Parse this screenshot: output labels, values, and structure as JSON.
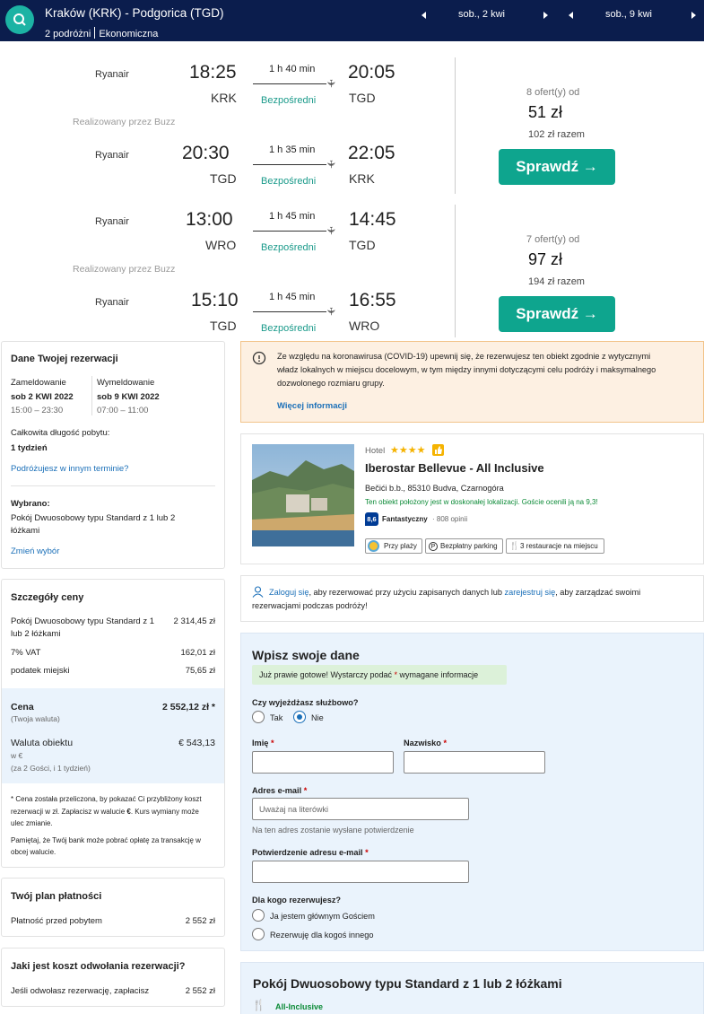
{
  "search": {
    "route": "Kraków (KRK) - Podgorica (TGD)",
    "travellers": "2 podróżni",
    "cabin": "Ekonomiczna",
    "depart_date": "sob., 2 kwi",
    "return_date": "sob., 9 kwi"
  },
  "flights": [
    {
      "legs": [
        {
          "airline": "Ryanair",
          "dep_time": "18:25",
          "arr_time": "20:05",
          "dep_code": "KRK",
          "arr_code": "TGD",
          "duration": "1 h 40 min",
          "stops": "Bezpośredni"
        },
        {
          "airline": "Ryanair",
          "dep_time": "20:30",
          "arr_time": "22:05",
          "dep_code": "TGD",
          "arr_code": "KRK",
          "duration": "1 h 35 min",
          "stops": "Bezpośredni"
        }
      ],
      "operated_by": "Realizowany przez Buzz",
      "offers": "8 ofert(y) od",
      "price": "51 zł",
      "total": "102 zł razem",
      "button": "Sprawdź →"
    },
    {
      "legs": [
        {
          "airline": "Ryanair",
          "dep_time": "13:00",
          "arr_time": "14:45",
          "dep_code": "WRO",
          "arr_code": "TGD",
          "duration": "1 h 45 min",
          "stops": "Bezpośredni"
        },
        {
          "airline": "Ryanair",
          "dep_time": "15:10",
          "arr_time": "16:55",
          "dep_code": "TGD",
          "arr_code": "WRO",
          "duration": "1 h 45 min",
          "stops": "Bezpośredni"
        }
      ],
      "operated_by": "Realizowany przez Buzz",
      "offers": "7 ofert(y) od",
      "price": "97 zł",
      "total": "194 zł razem",
      "button": "Sprawdź →"
    }
  ],
  "booking": {
    "title": "Dane Twojej rezerwacji",
    "checkin_label": "Zameldowanie",
    "checkin_date": "sob 2 KWI 2022",
    "checkin_time": "15:00 – 23:30",
    "checkout_label": "Wymeldowanie",
    "checkout_date": "sob 9 KWI 2022",
    "checkout_time": "07:00 – 11:00",
    "stay_label": "Całkowita długość pobytu:",
    "stay_value": "1 tydzień",
    "other_dates_link": "Podróżujesz w innym terminie?",
    "chosen_label": "Wybrano:",
    "chosen_value_1": "Pokój Dwuosobowy typu Standard z 1 lub 2",
    "chosen_value_2": "łóżkami",
    "change_link": "Zmień wybór"
  },
  "price_details": {
    "title": "Szczegóły ceny",
    "room_label_1": "Pokój Dwuosobowy typu Standard z 1",
    "room_label_2": "lub 2 łóżkami",
    "room_value": "2 314,45 zł",
    "vat_label": "7% VAT",
    "vat_value": "162,01 zł",
    "tax_label": "podatek miejski",
    "tax_value": "75,65 zł",
    "total_label": "Cena",
    "total_sub": "(Twoja waluta)",
    "total_value": "2 552,12 zł *",
    "local_label": "Waluta obiektu",
    "local_sub": "w €",
    "local_guests": "(za 2 Gości, i 1 tydzień)",
    "local_value": "€ 543,13",
    "note1_1": "* Cena została przeliczona, by pokazać Ci przybliżony koszt",
    "note1_2": "rezerwacji w zł. Zapłacisz w walucie",
    "note1_cur": "€",
    "note1_3": ". Kurs wymiany może",
    "note1_4": "ulec zmianie.",
    "note2_1": "Pamiętaj, że Twój bank może pobrać opłatę za transakcję w",
    "note2_2": "obcej walucie."
  },
  "payment": {
    "title": "Twój plan płatności",
    "label": "Płatność przed pobytem",
    "value": "2 552 zł"
  },
  "cancellation": {
    "title": "Jaki jest koszt odwołania rezerwacji?",
    "label": "Jeśli odwołasz rezerwację, zapłacisz",
    "value": "2 552 zł"
  },
  "covid": {
    "line1": "Ze względu na koronawirusa (COVID-19) upewnij się, że rezerwujesz ten obiekt zgodnie z wytycznymi",
    "line2": "władz lokalnych w miejscu docelowym, w tym między innymi dotyczącymi celu podróży i maksymalnego",
    "line3": "dozwolonego rozmiaru grupy.",
    "link": "Więcej informacji",
    "color": "#fdf0e2"
  },
  "hotel": {
    "type": "Hotel",
    "stars": "★★★★",
    "name": "Iberostar Bellevue - All Inclusive",
    "address": "Bečići b.b., 85310 Budva, Czarnogóra",
    "location_note": "Ten obiekt położony jest w doskonałej lokalizacji. Goście ocenili ją na 9,3!",
    "score": "8,6",
    "score_word": "Fantastyczny",
    "reviews": "· 808 opinii",
    "feature1": "Przy plaży",
    "feature2": "Bezpłatny parking",
    "feature3": "3 restauracje na miejscu"
  },
  "signin": {
    "link1": "Zaloguj się",
    "text1": ", aby rezerwować przy użyciu zapisanych danych lub",
    "link2": "zarejestruj się",
    "text2": ", aby zarządzać swoimi",
    "text3": "rezerwacjami podczas podróży!"
  },
  "form": {
    "title": "Wpisz swoje dane",
    "hint_pre": "Już prawie gotowe! Wystarczy podać",
    "hint_star": "*",
    "hint_post": "wymagane informacje",
    "business_q": "Czy wyjeżdżasz służbowo?",
    "opt_yes": "Tak",
    "opt_no": "Nie",
    "first_name": "Imię",
    "last_name": "Nazwisko",
    "req": "*",
    "email_label": "Adres e-mail",
    "email_placeholder": "Uważaj na literówki",
    "email_note": "Na ten adres zostanie wysłane potwierdzenie",
    "email_confirm_label": "Potwierdzenie adresu e-mail",
    "for_whom_q": "Dla kogo rezerwujesz?",
    "opt_me": "Ja jestem głównym Gościem",
    "opt_other": "Rezerwuję dla kogoś innego"
  },
  "room": {
    "title": "Pokój Dwuosobowy typu Standard z 1 lub 2 łóżkami",
    "board": "All-Inclusive"
  },
  "colors": {
    "topbar": "#0b1d4d",
    "accent": "#0ea58e",
    "link": "#1a6fb8",
    "panel_blue": "#eaf3fc"
  }
}
